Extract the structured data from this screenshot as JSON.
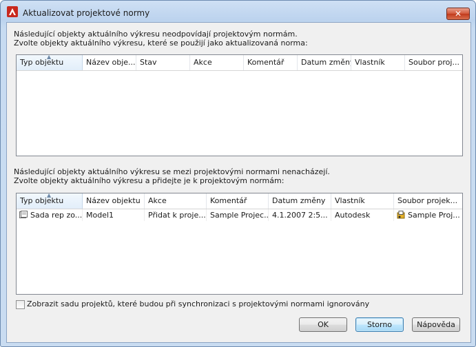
{
  "window": {
    "title": "Aktualizovat projektové normy",
    "close_glyph": "✕"
  },
  "top_section": {
    "line1": "Následující objekty aktuálního výkresu neodpovídají projektovým normám.",
    "line2": "Zvolte objekty aktuálního výkresu, které se použijí jako aktualizovaná norma:",
    "columns": [
      "Typ objektu",
      "Název obje...",
      "Stav",
      "Akce",
      "Komentář",
      "Datum změny",
      "Vlastník",
      "Soubor proj..."
    ],
    "rows": []
  },
  "bottom_section": {
    "line1": "Následující objekty aktuálního výkresu se mezi projektovými normami nenacházejí.",
    "line2": "Zvolte objekty aktuálního výkresu a přidejte je k projektovým normám:",
    "columns": [
      "Typ objektu",
      "Název objektu",
      "Akce",
      "Komentář",
      "Datum změny",
      "Vlastník",
      "Soubor projek..."
    ],
    "rows": [
      {
        "type": "Sada rep zo...",
        "name": "Model1",
        "action": "Přidat k proje...",
        "comment": "Sample Projec...",
        "date": "4.1.2007 2:5...",
        "owner": "Autodesk",
        "file": "Sample Proj..."
      }
    ]
  },
  "checkbox": {
    "label": "Zobrazit sadu projektů, které budou při synchronizaci s projektovými normami ignorovány",
    "checked": false
  },
  "buttons": {
    "ok": "OK",
    "cancel": "Storno",
    "help": "Nápověda"
  },
  "icons": {
    "app": "autocad-icon",
    "row_type": "display-configuration-icon",
    "row_file": "project-file-icon"
  },
  "colors": {
    "titlebar": "#c4d8f0",
    "close": "#c84b2c",
    "selected_header": "#e2eefa"
  }
}
